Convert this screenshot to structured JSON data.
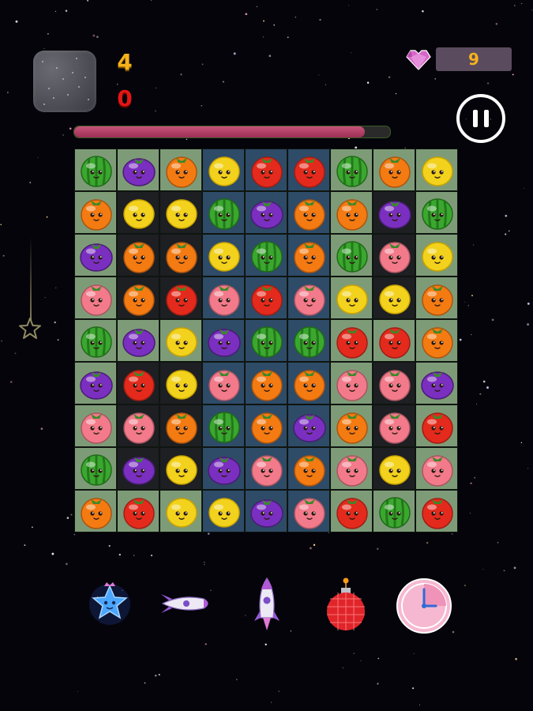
{
  "hud": {
    "score_top": "4",
    "score_bottom": "0",
    "gem_count": "9",
    "progress": 0.92
  },
  "colors": {
    "score_top": "#f5b21b",
    "score_bottom": "#e41616",
    "progress_fill": "#c8537a",
    "cell_green": "#7e9b78",
    "cell_dark": "#1d1f22",
    "cell_blue": "#2e4b68"
  },
  "icons": {
    "pause": "pause-icon",
    "gem": "heart-gem-icon",
    "star": "star-outline-icon"
  },
  "board": {
    "grid": [
      [
        "watermelon",
        "grape",
        "orange",
        "lemon",
        "tomato",
        "tomato",
        "watermelon",
        "orange",
        "lemon"
      ],
      [
        "orange",
        "lemon",
        "lemon",
        "watermelon",
        "grape",
        "orange",
        "orange",
        "grape",
        "watermelon"
      ],
      [
        "grape",
        "orange",
        "orange",
        "lemon",
        "watermelon",
        "orange",
        "watermelon",
        "peach",
        "lemon"
      ],
      [
        "peach",
        "orange",
        "tomato",
        "peach",
        "tomato",
        "peach",
        "lemon",
        "lemon",
        "orange"
      ],
      [
        "watermelon",
        "grape",
        "lemon",
        "grape",
        "watermelon",
        "watermelon",
        "tomato",
        "tomato",
        "orange"
      ],
      [
        "grape",
        "tomato",
        "lemon",
        "peach",
        "orange",
        "orange",
        "peach",
        "peach",
        "grape"
      ],
      [
        "peach",
        "peach",
        "orange",
        "watermelon",
        "orange",
        "grape",
        "orange",
        "peach",
        "tomato"
      ],
      [
        "watermelon",
        "grape",
        "lemon",
        "grape",
        "peach",
        "orange",
        "peach",
        "lemon",
        "peach"
      ],
      [
        "orange",
        "tomato",
        "lemon",
        "lemon",
        "grape",
        "peach",
        "tomato",
        "watermelon",
        "tomato"
      ]
    ],
    "tiles": [
      [
        "g",
        "g",
        "g",
        "b",
        "b",
        "b",
        "g",
        "g",
        "g"
      ],
      [
        "g",
        "d",
        "d",
        "b",
        "b",
        "b",
        "g",
        "d",
        "g"
      ],
      [
        "g",
        "d",
        "d",
        "b",
        "b",
        "b",
        "g",
        "d",
        "g"
      ],
      [
        "g",
        "d",
        "d",
        "b",
        "b",
        "b",
        "g",
        "d",
        "g"
      ],
      [
        "g",
        "g",
        "g",
        "b",
        "b",
        "b",
        "g",
        "g",
        "g"
      ],
      [
        "g",
        "d",
        "d",
        "b",
        "b",
        "b",
        "g",
        "d",
        "g"
      ],
      [
        "g",
        "d",
        "d",
        "b",
        "b",
        "b",
        "g",
        "d",
        "g"
      ],
      [
        "g",
        "d",
        "d",
        "b",
        "b",
        "b",
        "g",
        "d",
        "g"
      ],
      [
        "g",
        "g",
        "g",
        "b",
        "b",
        "b",
        "g",
        "g",
        "g"
      ]
    ],
    "fruit_colors": {
      "watermelon": "#3aa82e",
      "grape": "#7a2fc0",
      "orange": "#f47a12",
      "lemon": "#f2d21c",
      "tomato": "#e42a1c",
      "peach": "#f27a8a"
    }
  },
  "boosters": [
    "star-booster",
    "rocket-horizontal-booster",
    "rocket-vertical-booster",
    "disco-bomb-booster",
    "clock-booster"
  ]
}
